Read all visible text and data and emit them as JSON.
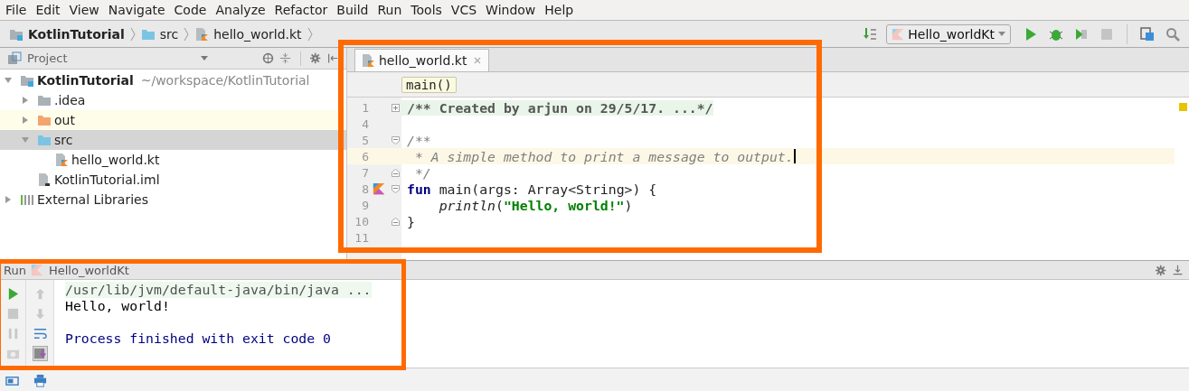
{
  "menu": [
    "File",
    "Edit",
    "View",
    "Navigate",
    "Code",
    "Analyze",
    "Refactor",
    "Build",
    "Run",
    "Tools",
    "VCS",
    "Window",
    "Help"
  ],
  "breadcrumbs": [
    {
      "label": "KotlinTutorial",
      "kind": "project"
    },
    {
      "label": "src",
      "kind": "source_folder"
    },
    {
      "label": "hello_world.kt",
      "kind": "kotlin_file"
    }
  ],
  "run_config": "Hello_worldKt",
  "project_panel": {
    "title": "Project",
    "tree": [
      {
        "label": "KotlinTutorial",
        "hint": "~/workspace/KotlinTutorial",
        "kind": "project",
        "expanded": true,
        "selected": false,
        "children": [
          {
            "label": ".idea",
            "kind": "folder",
            "expanded": false,
            "selected": false
          },
          {
            "label": "out",
            "kind": "excluded_folder",
            "expanded": false,
            "selected": false
          },
          {
            "label": "src",
            "kind": "source_folder",
            "expanded": true,
            "selected": true,
            "children": [
              {
                "label": "hello_world.kt",
                "kind": "kotlin_file",
                "selected": false
              }
            ]
          },
          {
            "label": "KotlinTutorial.iml",
            "kind": "iml_file",
            "selected": false
          }
        ]
      },
      {
        "label": "External Libraries",
        "kind": "library",
        "expanded": false,
        "selected": false
      }
    ]
  },
  "editor": {
    "tabs": [
      {
        "label": "hello_world.kt",
        "selected": true
      }
    ],
    "breadcrumb": "main()",
    "lines": [
      {
        "number": "1",
        "kind": "folded",
        "current": false,
        "segments": [
          {
            "text": "/** Created by arjun on 29/5/17. ...*/",
            "kind": "folded"
          }
        ]
      },
      {
        "number": "4",
        "kind": "blank",
        "current": false
      },
      {
        "number": "5",
        "kind": "block_start",
        "current": false,
        "segments": [
          {
            "text": "/**",
            "kind": "doc"
          }
        ]
      },
      {
        "number": "6",
        "kind": "inner",
        "current": true,
        "segments": [
          {
            "text": " * A simple method to print a message to output.",
            "kind": "doc"
          }
        ]
      },
      {
        "number": "7",
        "kind": "block_end",
        "current": false,
        "segments": [
          {
            "text": " */",
            "kind": "doc"
          }
        ]
      },
      {
        "number": "8",
        "kind": "function_start",
        "current": false,
        "segments": [
          {
            "text": "fun",
            "kind": "keyword"
          },
          {
            "text": " main(args: Array<String>) {",
            "kind": "plain"
          }
        ]
      },
      {
        "number": "9",
        "kind": "indented",
        "current": false,
        "segments": [
          {
            "text": "println",
            "kind": "call"
          },
          {
            "text": "(",
            "kind": "plain"
          },
          {
            "text": "\"Hello, world!\"",
            "kind": "string"
          },
          {
            "text": ")",
            "kind": "plain"
          }
        ]
      },
      {
        "number": "10",
        "kind": "block_end",
        "current": false,
        "segments": [
          {
            "text": "}",
            "kind": "plain"
          }
        ]
      },
      {
        "number": "11",
        "kind": "blank",
        "current": false
      }
    ]
  },
  "run_panel": {
    "title": "Run",
    "config": "Hello_worldKt",
    "output": [
      {
        "text": "/usr/lib/jvm/default-java/bin/java ...",
        "kind": "command"
      },
      {
        "text": "Hello, world!",
        "kind": "stdout"
      },
      {
        "text": "Process finished with exit code 0",
        "kind": "system"
      }
    ]
  }
}
